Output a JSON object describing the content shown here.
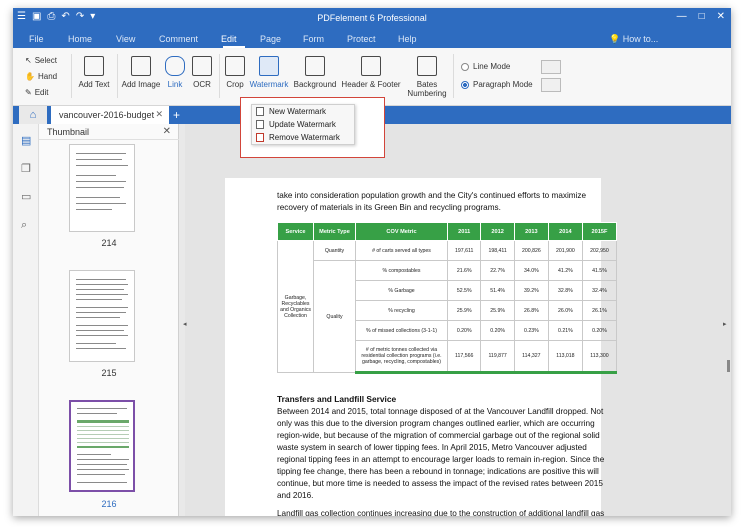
{
  "app": {
    "title": "PDFelement 6 Professional",
    "quick_access": [
      "☰",
      "▣",
      "⎙",
      "↶",
      "↷",
      "▾"
    ],
    "window_controls": [
      "—",
      "□",
      "✕"
    ]
  },
  "menu": {
    "items": [
      "File",
      "Home",
      "View",
      "Comment",
      "Edit",
      "Page",
      "Form",
      "Protect",
      "Help"
    ],
    "active": "Edit",
    "howto": "How to..."
  },
  "ribbon": {
    "modes": [
      "Select",
      "Hand",
      "Edit"
    ],
    "buttons": {
      "add_text": "Add Text",
      "add_image": "Add Image",
      "link": "Link",
      "ocr": "OCR",
      "crop": "Crop",
      "watermark": "Watermark",
      "background": "Background",
      "header_footer": "Header & Footer",
      "bates_1": "Bates",
      "bates_2": "Numbering"
    },
    "line_mode": "Line Mode",
    "paragraph_mode": "Paragraph Mode",
    "selected_mode": "Paragraph Mode"
  },
  "tabs": {
    "doc": "vancouver-2016-budget",
    "close": "✕",
    "add": "+"
  },
  "thumbnail_panel": {
    "title": "Thumbnail",
    "close": "✕",
    "pages": [
      "214",
      "215",
      "216"
    ],
    "selected": "216"
  },
  "watermark_menu": {
    "items": [
      "New Watermark",
      "Update Watermark",
      "Remove Watermark"
    ]
  },
  "document": {
    "intro": "take into consideration population growth and the City's continued efforts to maximize recovery of materials in its Green Bin and recycling programs.",
    "table": {
      "headers": [
        "Service",
        "Metric Type",
        "COV Metric",
        "2011",
        "2012",
        "2013",
        "2014",
        "2015F"
      ],
      "service": "Garbage, Recyclables and Organics Collection",
      "metric_quantity": "Quantity",
      "metric_quality": "Quality",
      "rows": [
        [
          "# of carts served all types",
          "197,611",
          "198,411",
          "200,826",
          "201,900",
          "202,950"
        ],
        [
          "% compostables",
          "21.6%",
          "22.7%",
          "34.0%",
          "41.2%",
          "41.5%"
        ],
        [
          "% Garbage",
          "52.5%",
          "51.4%",
          "39.2%",
          "32.8%",
          "32.4%"
        ],
        [
          "% recycling",
          "25.9%",
          "25.9%",
          "26.8%",
          "26.0%",
          "26.1%"
        ],
        [
          "% of missed collections (3-1-1)",
          "0.20%",
          "0.20%",
          "0.23%",
          "0.21%",
          "0.20%"
        ],
        [
          "# of metric tonnes collected via residential collection programs (i.e. garbage, recycling, compostables)",
          "117,566",
          "119,877",
          "114,327",
          "113,018",
          "113,300"
        ]
      ]
    },
    "section_heading": "Transfers and Landfill Service",
    "section_body": "Between 2014 and 2015, total tonnage disposed of at the Vancouver Landfill dropped. Not only was this due to the diversion program changes outlined earlier, which are occurring region-wide, but because of the migration of commercial garbage out of the regional solid waste system in search of lower tipping fees. In April 2015, Metro Vancouver adjusted regional tipping fees in an attempt to encourage larger loads to remain in-region. Since the tipping fee change, there has been a rebound in tonnage; indications are positive this will continue, but more time is needed to assess the impact of the revised rates between 2015 and 2016.",
    "last_line": "Landfill gas collection continues increasing due to the construction of additional landfill gas"
  },
  "colors": {
    "brand_blue": "#2e6cc0",
    "table_green": "#37a046",
    "highlight_red": "#d2453a",
    "selection_purple": "#7c4fa8"
  }
}
